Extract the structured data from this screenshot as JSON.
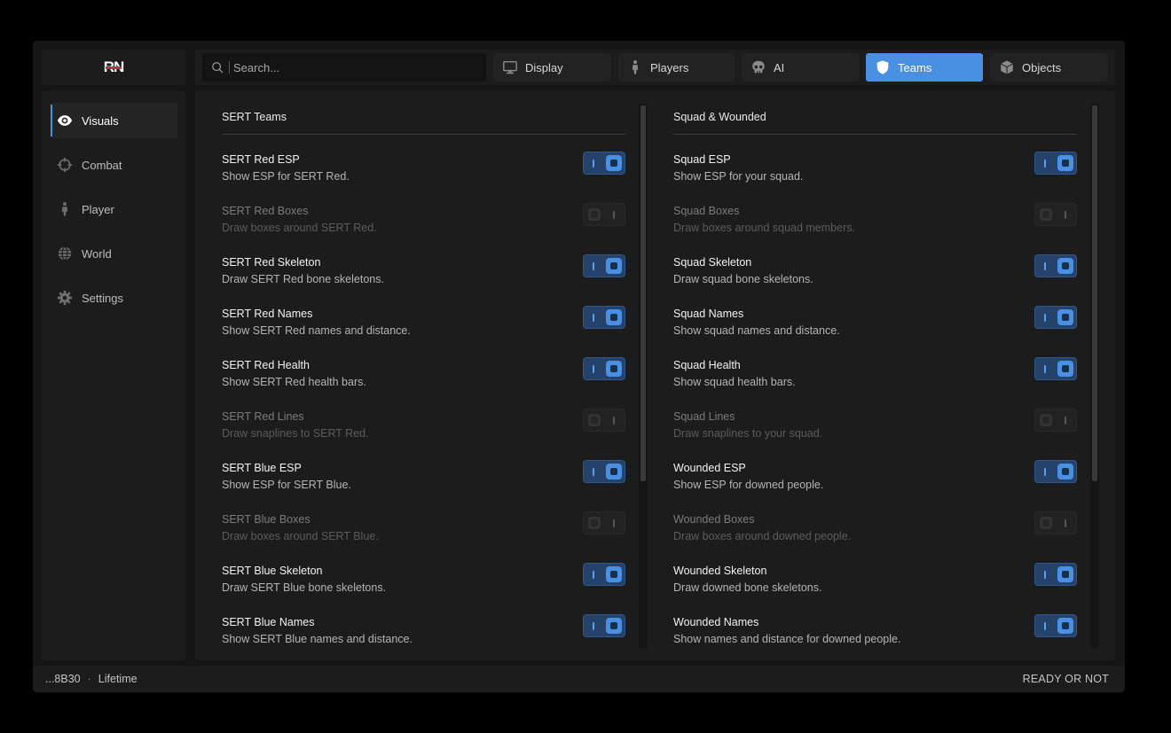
{
  "app": {
    "logo_text": "RN"
  },
  "search": {
    "placeholder": "Search..."
  },
  "tabs": [
    {
      "label": "Display",
      "icon": "monitor-icon",
      "active": false
    },
    {
      "label": "Players",
      "icon": "person-icon",
      "active": false
    },
    {
      "label": "AI",
      "icon": "skull-icon",
      "active": false
    },
    {
      "label": "Teams",
      "icon": "shield-icon",
      "active": true
    },
    {
      "label": "Objects",
      "icon": "cube-icon",
      "active": false
    }
  ],
  "sidebar": {
    "items": [
      {
        "label": "Visuals",
        "icon": "eye-icon",
        "active": true
      },
      {
        "label": "Combat",
        "icon": "crosshair-icon",
        "active": false
      },
      {
        "label": "Player",
        "icon": "person-icon",
        "active": false
      },
      {
        "label": "World",
        "icon": "globe-icon",
        "active": false
      },
      {
        "label": "Settings",
        "icon": "gear-icon",
        "active": false
      }
    ]
  },
  "left_section": {
    "title": "SERT Teams",
    "rows": [
      {
        "label": "SERT Red ESP",
        "desc": "Show ESP for SERT Red.",
        "on": true
      },
      {
        "label": "SERT Red Boxes",
        "desc": "Draw boxes around SERT Red.",
        "on": false
      },
      {
        "label": "SERT Red Skeleton",
        "desc": "Draw SERT Red bone skeletons.",
        "on": true
      },
      {
        "label": "SERT Red Names",
        "desc": "Show SERT Red names and distance.",
        "on": true
      },
      {
        "label": "SERT Red Health",
        "desc": "Show SERT Red health bars.",
        "on": true
      },
      {
        "label": "SERT Red Lines",
        "desc": "Draw snaplines to SERT Red.",
        "on": false
      },
      {
        "label": "SERT Blue ESP",
        "desc": "Show ESP for SERT Blue.",
        "on": true
      },
      {
        "label": "SERT Blue Boxes",
        "desc": "Draw boxes around SERT Blue.",
        "on": false
      },
      {
        "label": "SERT Blue Skeleton",
        "desc": "Draw SERT Blue bone skeletons.",
        "on": true
      },
      {
        "label": "SERT Blue Names",
        "desc": "Show SERT Blue names and distance.",
        "on": true
      }
    ]
  },
  "right_section": {
    "title": "Squad & Wounded",
    "rows": [
      {
        "label": "Squad ESP",
        "desc": "Show ESP for your squad.",
        "on": true
      },
      {
        "label": "Squad Boxes",
        "desc": "Draw boxes around squad members.",
        "on": false
      },
      {
        "label": "Squad Skeleton",
        "desc": "Draw squad bone skeletons.",
        "on": true
      },
      {
        "label": "Squad Names",
        "desc": "Show squad names and distance.",
        "on": true
      },
      {
        "label": "Squad Health",
        "desc": "Show squad health bars.",
        "on": true
      },
      {
        "label": "Squad Lines",
        "desc": "Draw snaplines to your squad.",
        "on": false
      },
      {
        "label": "Wounded ESP",
        "desc": "Show ESP for downed people.",
        "on": true
      },
      {
        "label": "Wounded Boxes",
        "desc": "Draw boxes around downed people.",
        "on": false
      },
      {
        "label": "Wounded Skeleton",
        "desc": "Draw downed bone skeletons.",
        "on": true
      },
      {
        "label": "Wounded Names",
        "desc": "Show names and distance for downed people.",
        "on": true
      }
    ]
  },
  "footer": {
    "key": "...8B30",
    "separator": "·",
    "plan": "Lifetime",
    "game": "READY OR NOT"
  },
  "colors": {
    "accent": "#4a90e2",
    "background": "#151515",
    "panel": "#1c1c1c"
  }
}
